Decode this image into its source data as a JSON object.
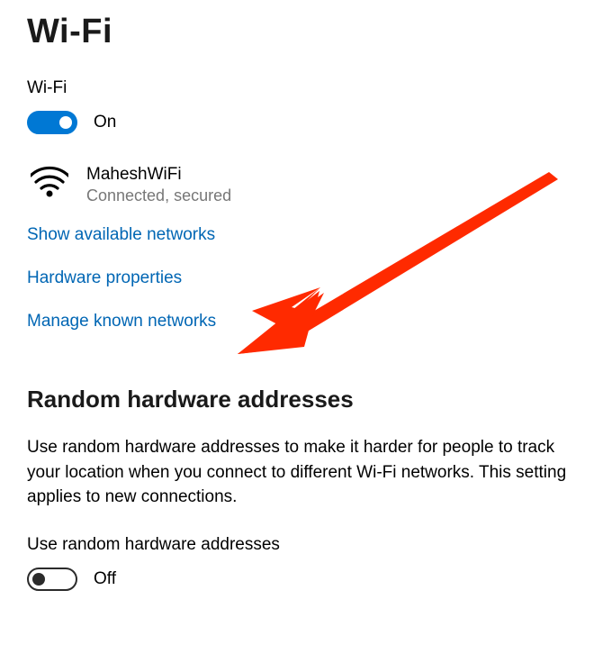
{
  "page": {
    "title": "Wi-Fi"
  },
  "wifi": {
    "label": "Wi-Fi",
    "toggle_state": "On",
    "toggle_on": true,
    "network": {
      "name": "MaheshWiFi",
      "status": "Connected, secured"
    },
    "links": {
      "show_available": "Show available networks",
      "hardware_props": "Hardware properties",
      "manage_known": "Manage known networks"
    }
  },
  "random_hw": {
    "title": "Random hardware addresses",
    "description": "Use random hardware addresses to make it harder for people to track your location when you connect to different Wi-Fi networks. This setting applies to new connections.",
    "label": "Use random hardware addresses",
    "toggle_state": "Off",
    "toggle_on": false
  }
}
